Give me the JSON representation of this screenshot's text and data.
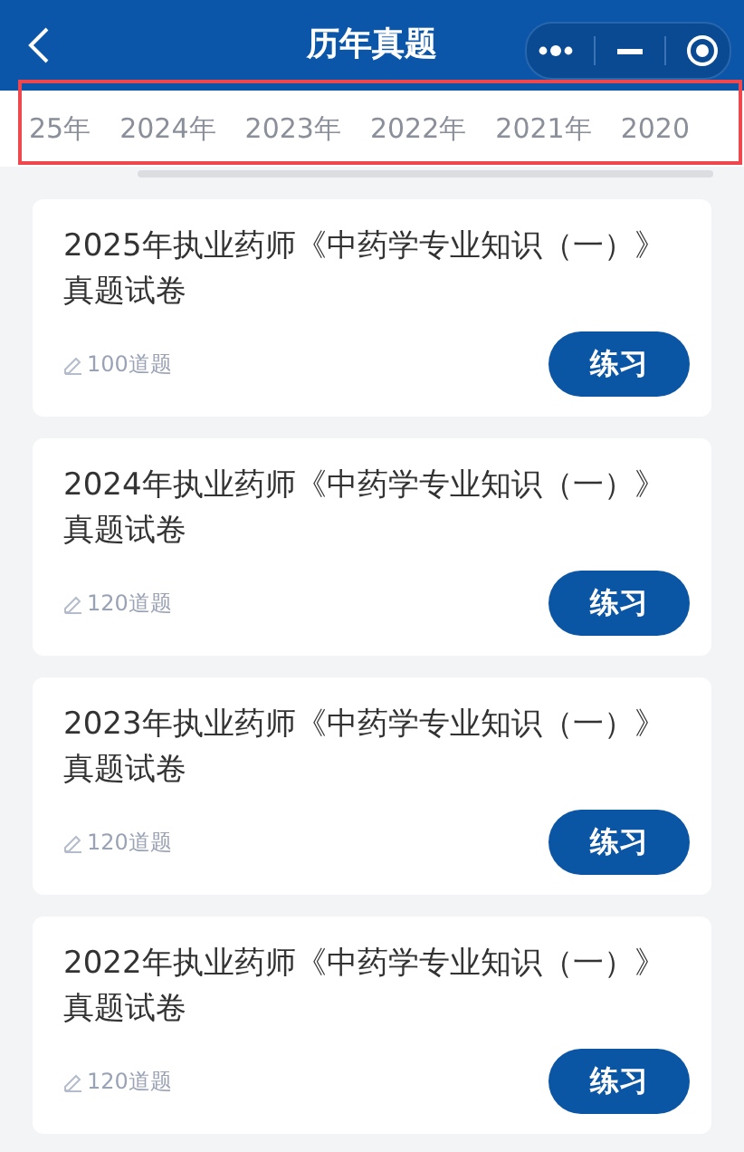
{
  "header": {
    "title": "历年真题"
  },
  "year_tabs": [
    {
      "label": "25年"
    },
    {
      "label": "2024年"
    },
    {
      "label": "2023年"
    },
    {
      "label": "2022年"
    },
    {
      "label": "2021年"
    },
    {
      "label": "2020"
    }
  ],
  "papers": [
    {
      "title": "2025年执业药师《中药学专业知识（一）》真题试卷",
      "count": "100道题",
      "action": "练习"
    },
    {
      "title": "2024年执业药师《中药学专业知识（一）》真题试卷",
      "count": "120道题",
      "action": "练习"
    },
    {
      "title": "2023年执业药师《中药学专业知识（一）》真题试卷",
      "count": "120道题",
      "action": "练习"
    },
    {
      "title": "2022年执业药师《中药学专业知识（一）》真题试卷",
      "count": "120道题",
      "action": "练习"
    }
  ]
}
